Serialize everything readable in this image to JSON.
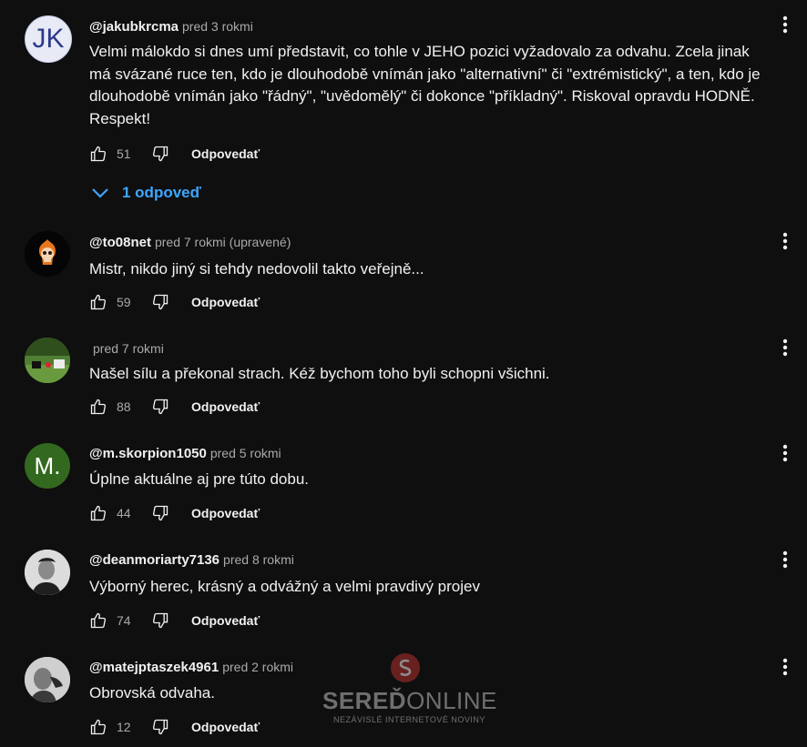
{
  "comments": [
    {
      "author": "@jakubkrcma",
      "time": "pred 3 rokmi",
      "avatar_initials": "JK",
      "avatar_style": "initials-light",
      "text": "Velmi málokdo si dnes umí představit, co tohle v JEHO pozici vyžadovalo za odvahu. Zcela jinak má svázané ruce ten, kdo je dlouhodobě vnímán jako \"alternativní\" či \"extrémistický\", a ten, kdo je dlouhodobě vnímán jako \"řádný\", \"uvědomělý\" či dokonce \"příkladný\". Riskoval opravdu HODNĚ. Respekt!",
      "likes": "51",
      "reply_label": "Odpovedať"
    },
    {
      "author": "@to08net",
      "time": "pred 7 rokmi (upravené)",
      "avatar_style": "skull-fire",
      "text": "Mistr, nikdo jiný si tehdy nedovolil takto veřejně...",
      "likes": "59",
      "reply_label": "Odpovedať"
    },
    {
      "author": "",
      "time": "pred 7 rokmi",
      "avatar_style": "photo-green",
      "text": "Našel sílu a překonal strach. Kéž bychom toho byli schopni všichni.",
      "likes": "88",
      "reply_label": "Odpovedať"
    },
    {
      "author": "@m.skorpion1050",
      "time": "pred 5 rokmi",
      "avatar_initials": "M.",
      "avatar_style": "initials-green",
      "text": "Úplne aktuálne aj pre túto dobu.",
      "likes": "44",
      "reply_label": "Odpovedať"
    },
    {
      "author": "@deanmoriarty7136",
      "time": "pred 8 rokmi",
      "avatar_style": "photo-bw",
      "text": "Výborný herec, krásný a odvážný a velmi pravdivý projev",
      "likes": "74",
      "reply_label": "Odpovedať"
    },
    {
      "author": "@matejptaszek4961",
      "time": "pred 2 rokmi",
      "avatar_style": "photo-bw2",
      "text": "Obrovská odvaha.",
      "likes": "12",
      "reply_label": "Odpovedať"
    }
  ],
  "replies_toggle": "1 odpoveď",
  "watermark": {
    "title_bold": "SEREĎ",
    "title_light": "ONLINE",
    "subtitle": "NEZÁVISLÉ INTERNETOVÉ NOVINY"
  },
  "colors": {
    "background": "#0f0f0f",
    "link_blue": "#3ea6ff",
    "avatar_jk_bg": "#e8eaf6",
    "avatar_jk_text": "#2d3a8c",
    "avatar_m_bg": "#33691e"
  }
}
